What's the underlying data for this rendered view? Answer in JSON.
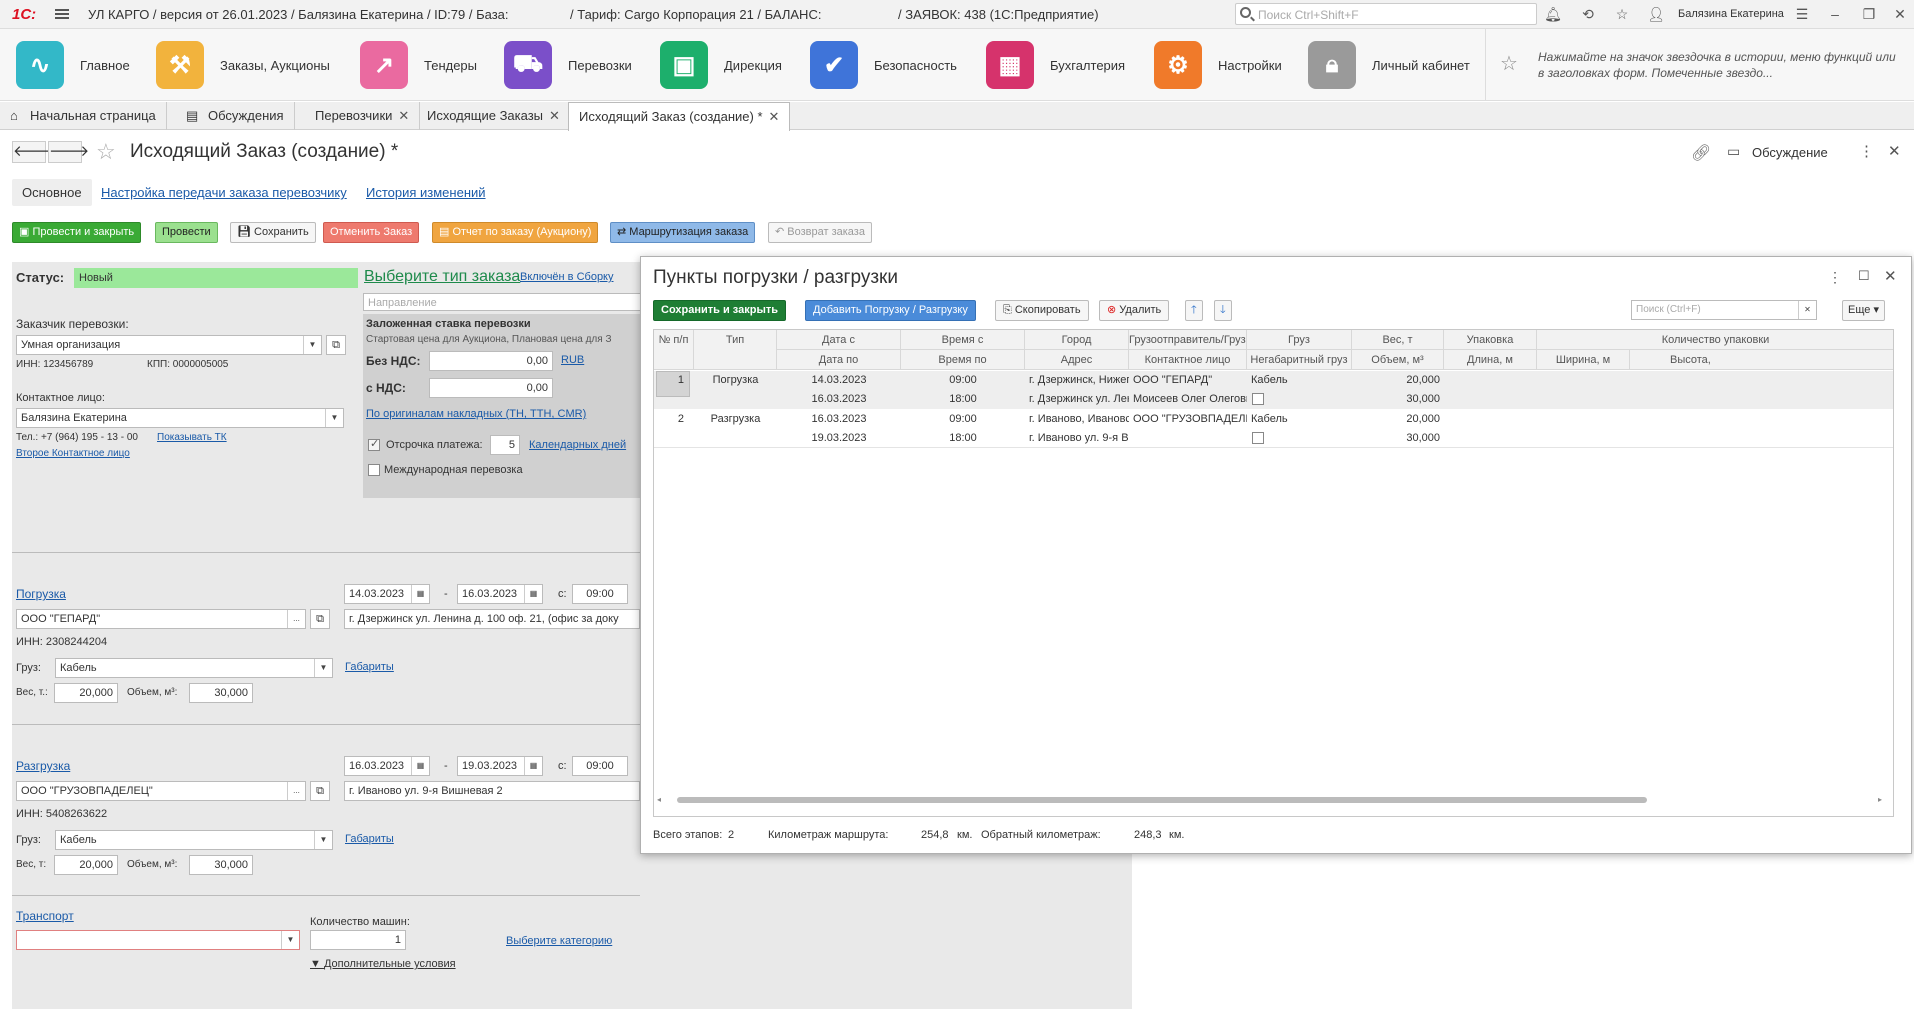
{
  "titlebar": {
    "app": "1С:",
    "title": "УЛ КАРГО / версия от 26.01.2023 / Балязина Екатерина / ID:79 / База:",
    "tariff": "/ Тариф: Cargo Корпорация 21 / БАЛАНС:",
    "orders": "/ ЗАЯВОК: 438  (1С:Предприятие)",
    "search_placeholder": "Поиск Ctrl+Shift+F",
    "user": "Балязина Екатерина"
  },
  "sections": [
    {
      "label": "Главное",
      "color": "#33b8c8",
      "icon": "main-icon"
    },
    {
      "label": "Заказы, Аукционы",
      "color": "#f2b33d",
      "icon": "auction-icon"
    },
    {
      "label": "Тендеры",
      "color": "#ea6aa0",
      "icon": "chart-icon"
    },
    {
      "label": "Перевозки",
      "color": "#7b4fc9",
      "icon": "truck-icon"
    },
    {
      "label": "Дирекция",
      "color": "#1daf6c",
      "icon": "briefcase-icon"
    },
    {
      "label": "Безопасность",
      "color": "#3f74d9",
      "icon": "shield-icon"
    },
    {
      "label": "Бухгалтерия",
      "color": "#d6336c",
      "icon": "calculator-icon"
    },
    {
      "label": "Настройки",
      "color": "#f07a2a",
      "icon": "gear-icon"
    },
    {
      "label": "Личный кабинет",
      "color": "#9a9a9a",
      "icon": "lock-icon"
    }
  ],
  "favorites_hint": "Нажимайте на значок звездочка в истории, меню функций или в заголовках форм. Помеченные звездо...",
  "tabs": [
    {
      "label": "Начальная страница"
    },
    {
      "label": "Обсуждения"
    },
    {
      "label": "Перевозчики"
    },
    {
      "label": "Исходящие Заказы"
    },
    {
      "label": "Исходящий Заказ (создание) *"
    }
  ],
  "form": {
    "title": "Исходящий Заказ (создание) *",
    "discussion": "Обсуждение",
    "subtabs": [
      "Основное",
      "Настройка передачи заказа перевозчику",
      "История изменений"
    ],
    "buttons": [
      "Провести и закрыть",
      "Провести",
      "Сохранить",
      "Отменить Заказ",
      "Отчет по заказу (Аукциону)",
      "Маршрутизация заказа",
      "Возврат заказа"
    ]
  },
  "left": {
    "status_label": "Статус:",
    "status_value": "Новый",
    "order_type_link": "Выберите тип заказа",
    "included_link": "Включён в Сборку",
    "direction_placeholder": "Направление",
    "customer_label": "Заказчик перевозки:",
    "customer": "Умная организация",
    "inn": "ИНН: 123456789",
    "kpp": "КПП: 0000005005",
    "contact_label": "Контактное лицо:",
    "contact": "Балязина Екатерина",
    "phone": "Тел.: +7 (964) 195 - 13 - 00",
    "show_tk": "Показывать ТК",
    "second_contact": "Второе Контактное лицо",
    "rate_title": "Заложенная ставка перевозки",
    "rate_sub": "Стартовая цена для Аукциона, Плановая цена для З",
    "no_vat_label": "Без НДС:",
    "no_vat": "0,00",
    "currency": "RUB",
    "vat_label": "с НДС:",
    "vat": "0,00",
    "originals_link": "По оригиналам накладных (ТН, ТТН, CMR)",
    "deferral_label": "Отсрочка платежа:",
    "deferral": "5",
    "calendar_days": "Календарных дней",
    "international": "Международная перевозка",
    "loading": {
      "title": "Погрузка",
      "date_from": "14.03.2023",
      "date_to": "16.03.2023",
      "from_label": "с:",
      "time": "09:00",
      "company": "ООО \"ГЕПАРД\"",
      "address": "г. Дзержинск ул. Ленина д. 100 оф. 21, (офис за доку",
      "inn": "ИНН: 2308244204",
      "cargo_label": "Груз:",
      "cargo": "Кабель",
      "dims": "Габариты",
      "weight_label": "Вес, т.:",
      "weight": "20,000",
      "volume_label": "Объем, м³:",
      "volume": "30,000"
    },
    "unloading": {
      "title": "Разгрузка",
      "date_from": "16.03.2023",
      "date_to": "19.03.2023",
      "from_label": "с:",
      "time": "09:00",
      "company": "ООО \"ГРУЗОВПАДЕЛЕЦ\"",
      "address": "г. Иваново ул. 9-я Вишневая 2",
      "inn": "ИНН: 5408263622",
      "cargo_label": "Груз:",
      "cargo": "Кабель",
      "dims": "Габариты",
      "weight_label": "Вес, т:",
      "weight": "20,000",
      "volume_label": "Объем, м³:",
      "volume": "30,000"
    },
    "transport": {
      "title": "Транспорт",
      "machines_label": "Количество машин:",
      "machines": "1",
      "category_link": "Выберите категорию",
      "extra": "Дополнительные условия"
    }
  },
  "dialog": {
    "title": "Пункты погрузки / разгрузки",
    "buttons": {
      "save": "Сохранить и закрыть",
      "add": "Добавить Погрузку / Разгрузку",
      "copy": "Скопировать",
      "delete": "Удалить",
      "more": "Еще"
    },
    "search_placeholder": "Поиск (Ctrl+F)",
    "headers_top": [
      "№ п/п",
      "Тип",
      "Дата с",
      "Время с",
      "Город",
      "Грузоотправитель/Грузо...",
      "Груз",
      "Вес, т",
      "Упаковка",
      "Количество упаковки"
    ],
    "headers_bottom": [
      "Дата по",
      "Время по",
      "Адрес",
      "Контактное лицо",
      "Негабаритный груз",
      "Объем, м³",
      "Длина, м",
      "Ширина, м",
      "Высота,"
    ],
    "rows": [
      {
        "n": "1",
        "type": "Погрузка",
        "date_from": "14.03.2023",
        "date_to": "16.03.2023",
        "time_from": "09:00",
        "time_to": "18:00",
        "city": "г. Дзержинск,  Нижег...",
        "address": "г. Дзержинск ул. Лен...",
        "shipper": "ООО \"ГЕПАРД\"",
        "contact": "Моисеев Олег Олегович",
        "cargo": "Кабель",
        "weight": "20,000",
        "volume": "30,000"
      },
      {
        "n": "2",
        "type": "Разгрузка",
        "date_from": "16.03.2023",
        "date_to": "19.03.2023",
        "time_from": "09:00",
        "time_to": "18:00",
        "city": "г. Иваново, Ивановск...",
        "address": "г. Иваново ул. 9-я Ви...",
        "shipper": "ООО \"ГРУЗОВПАДЕЛЕЦ\"",
        "contact": "",
        "cargo": "Кабель",
        "weight": "20,000",
        "volume": "30,000"
      }
    ],
    "footer": {
      "stages_label": "Всего этапов:",
      "stages": "2",
      "km_label": "Километраж маршрута:",
      "km": "254,8",
      "km_unit": "км.",
      "back_label": "Обратный километраж:",
      "back": "248,3",
      "back_unit": "км."
    }
  }
}
